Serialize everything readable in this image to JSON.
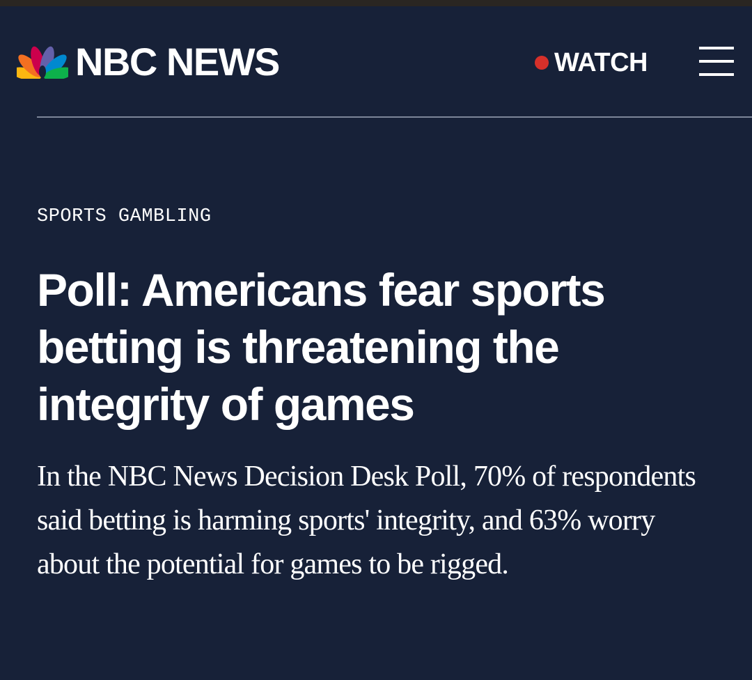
{
  "header": {
    "logo_text": "NBC NEWS",
    "logo_icon": "nbc-peacock-icon",
    "watch_label": "WATCH",
    "live_dot_color": "#d6302a",
    "menu_icon": "hamburger-menu-icon"
  },
  "article": {
    "eyebrow": "SPORTS GAMBLING",
    "headline": "Poll: Americans fear sports betting is threatening the integrity of games",
    "dek": "In the NBC News Decision Desk Poll, 70% of respondents said betting is harming sports' integrity, and 63% worry about the potential for games to be rigged."
  },
  "colors": {
    "background": "#172138",
    "text": "#ffffff",
    "divider": "#7d8699",
    "peacock": [
      "#fcb711",
      "#f37021",
      "#cc004c",
      "#6460aa",
      "#0089d0",
      "#0db14b"
    ]
  }
}
